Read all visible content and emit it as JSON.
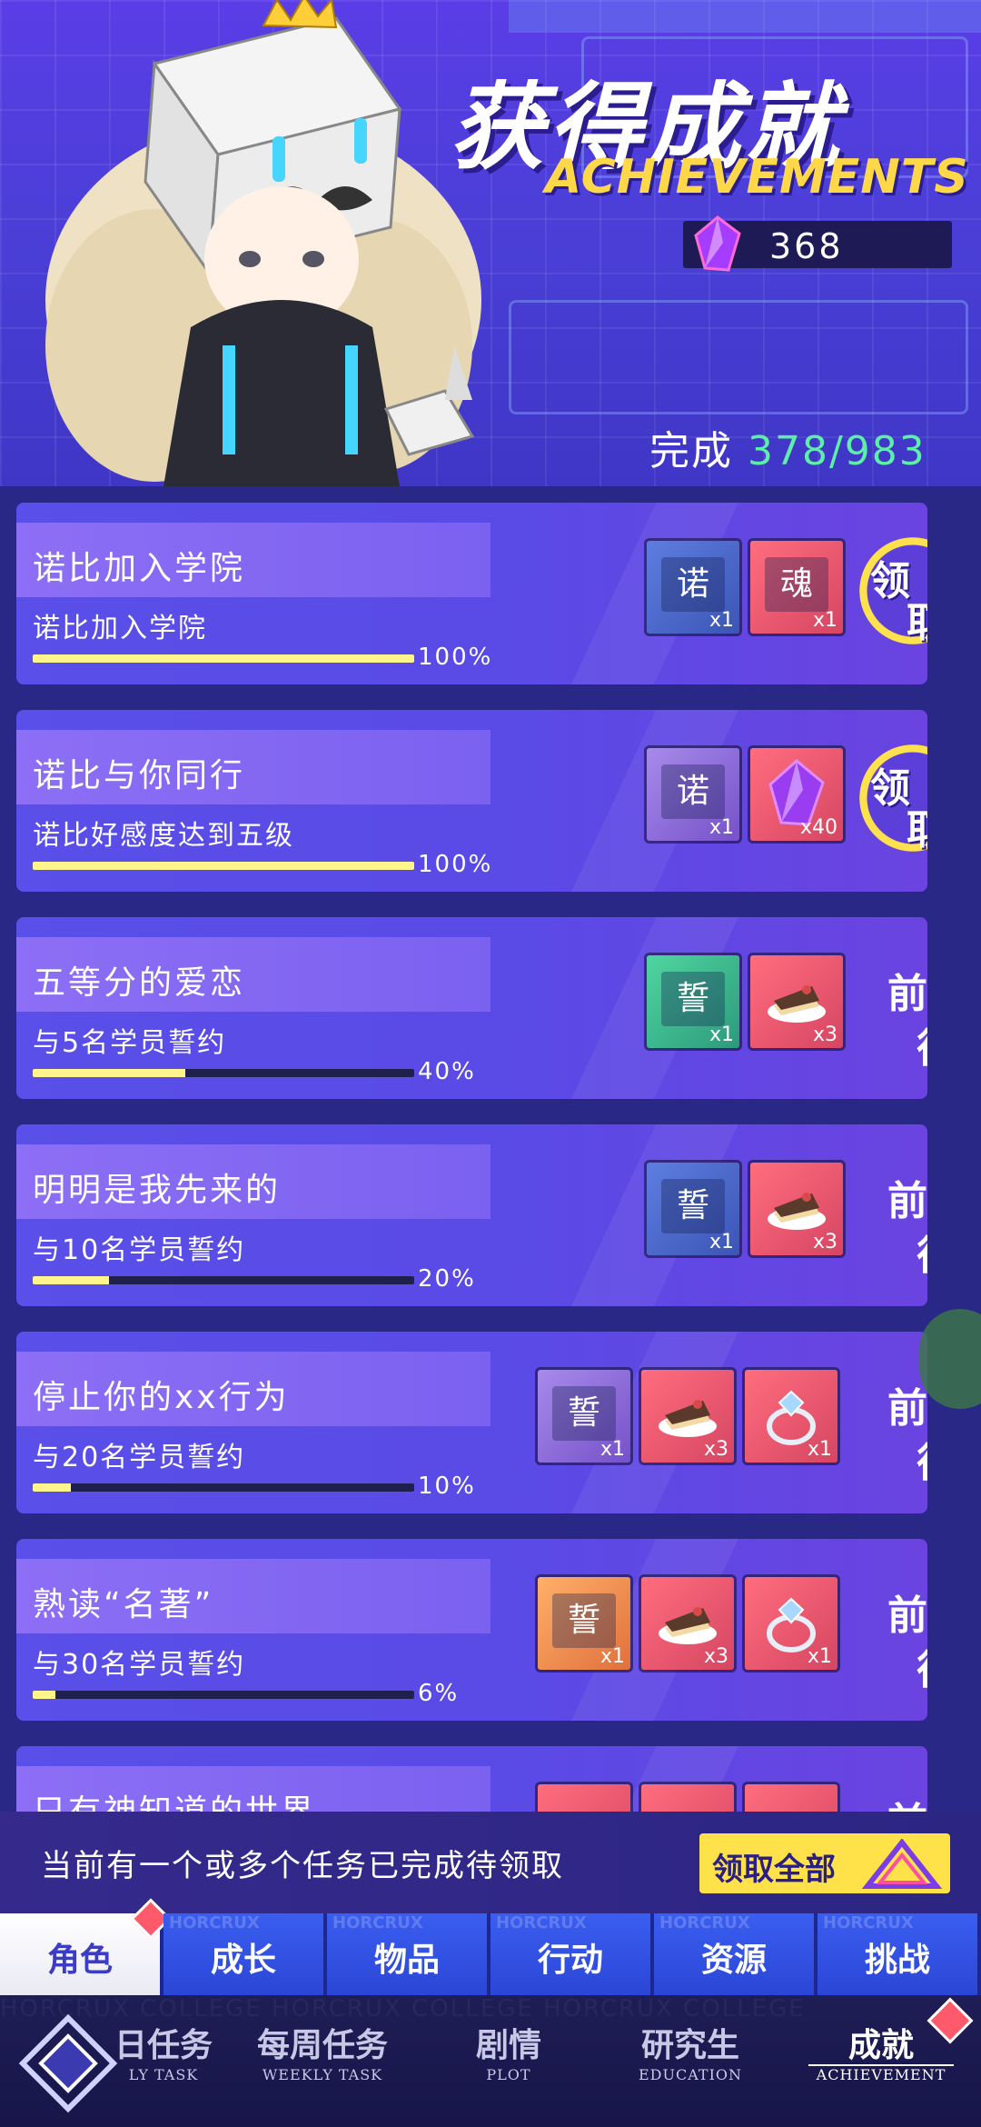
{
  "header": {
    "title_cn": "获得成就",
    "title_en": "ACHIEVEMENTS",
    "gem_count": "368",
    "completion_label": "完成",
    "completion_value": "378/983"
  },
  "achievements": [
    {
      "title": "诺比加入学院",
      "desc": "诺比加入学院",
      "progress": 1.0,
      "percent": "100%",
      "rewards": [
        {
          "glyph": "诺",
          "qty": "x1",
          "style": "blue"
        },
        {
          "glyph": "魂",
          "qty": "x1",
          "style": "card"
        }
      ],
      "action": "claim",
      "action_labels": [
        "领",
        "取"
      ]
    },
    {
      "title": "诺比与你同行",
      "desc": "诺比好感度达到五级",
      "progress": 1.0,
      "percent": "100%",
      "rewards": [
        {
          "glyph": "诺",
          "qty": "x1",
          "style": "purple"
        },
        {
          "glyph": "crystal",
          "qty": "x40",
          "style": "red"
        }
      ],
      "action": "claim",
      "action_labels": [
        "领",
        "取"
      ]
    },
    {
      "title": "五等分的爱恋",
      "desc": "与5名学员誓约",
      "progress": 0.4,
      "percent": "40%",
      "rewards": [
        {
          "glyph": "誓",
          "qty": "x1",
          "style": "green"
        },
        {
          "glyph": "cake",
          "qty": "x3",
          "style": "red"
        }
      ],
      "action": "go",
      "action_labels": [
        "前",
        "往"
      ]
    },
    {
      "title": "明明是我先来的",
      "desc": "与10名学员誓约",
      "progress": 0.2,
      "percent": "20%",
      "rewards": [
        {
          "glyph": "誓",
          "qty": "x1",
          "style": "blue"
        },
        {
          "glyph": "cake",
          "qty": "x3",
          "style": "red"
        }
      ],
      "action": "go",
      "action_labels": [
        "前",
        "往"
      ]
    },
    {
      "title": "停止你的xx行为",
      "desc": "与20名学员誓约",
      "progress": 0.1,
      "percent": "10%",
      "rewards": [
        {
          "glyph": "誓",
          "qty": "x1",
          "style": "purple"
        },
        {
          "glyph": "cake",
          "qty": "x3",
          "style": "red"
        },
        {
          "glyph": "ring",
          "qty": "x1",
          "style": "red"
        }
      ],
      "action": "go",
      "action_labels": [
        "前",
        "往"
      ]
    },
    {
      "title": "熟读“名著”",
      "desc": "与30名学员誓约",
      "progress": 0.06,
      "percent": "6%",
      "rewards": [
        {
          "glyph": "誓",
          "qty": "x1",
          "style": "orange"
        },
        {
          "glyph": "cake",
          "qty": "x3",
          "style": "red"
        },
        {
          "glyph": "ring",
          "qty": "x1",
          "style": "red"
        }
      ],
      "action": "go",
      "action_labels": [
        "前",
        "往"
      ]
    },
    {
      "title": "只有神知道的世界",
      "desc": "",
      "progress": 0,
      "percent": "",
      "rewards": [
        {
          "glyph": "",
          "qty": "",
          "style": "red"
        },
        {
          "glyph": "",
          "qty": "",
          "style": "red"
        },
        {
          "glyph": "",
          "qty": "",
          "style": "red"
        }
      ],
      "action": "go",
      "action_labels": [
        "前",
        ""
      ]
    }
  ],
  "notice": {
    "text": "当前有一个或多个任务已完成待领取",
    "button": "领取全部"
  },
  "category_tabs": [
    "角色",
    "成长",
    "物品",
    "行动",
    "资源",
    "挑战"
  ],
  "category_watermark": "HORCRUX",
  "bottom_nav": [
    {
      "cn": "日任务",
      "en": "LY TASK"
    },
    {
      "cn": "每周任务",
      "en": "WEEKLY TASK"
    },
    {
      "cn": "剧情",
      "en": "PLOT"
    },
    {
      "cn": "研究生",
      "en": "EDUCATION"
    },
    {
      "cn": "成就",
      "en": "ACHIEVEMENT"
    }
  ],
  "bottom_watermark": "HORCRUX COLLEGE HORCRUX COLLEGE HORCRUX COLLEGE",
  "colors": {
    "accent": "#5a4fe8",
    "progress": "#fff58c",
    "claim": "#ffe14d",
    "complete_value": "#5cf0a6"
  }
}
